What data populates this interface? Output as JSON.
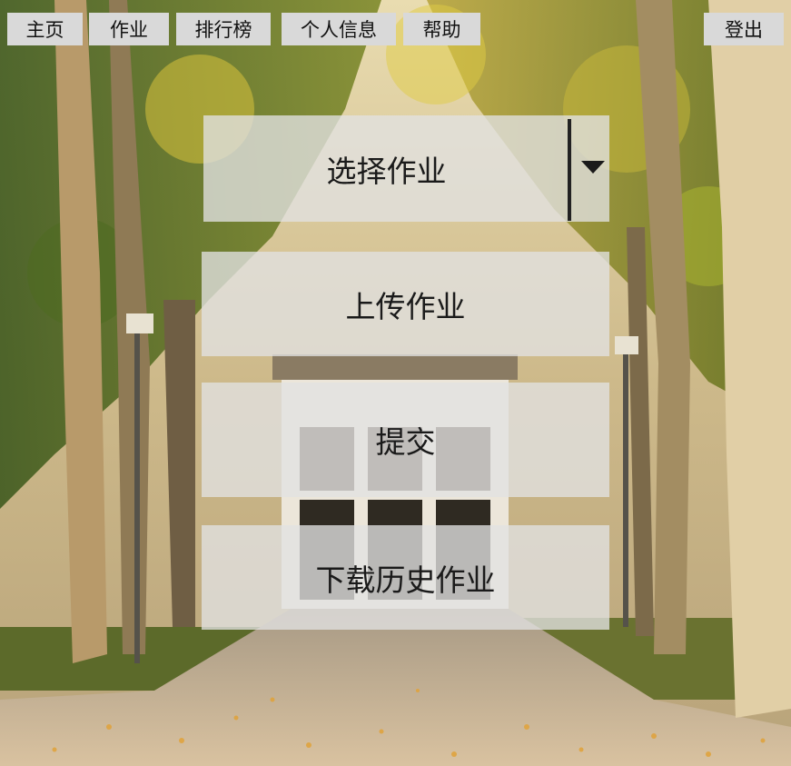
{
  "nav": {
    "home": "主页",
    "homework": "作业",
    "ranking": "排行榜",
    "profile": "个人信息",
    "help": "帮助",
    "logout": "登出"
  },
  "homework_select": {
    "selected": "选择作业",
    "icon": "chevron-down-icon"
  },
  "actions": {
    "upload": "上传作业",
    "submit": "提交",
    "download_history": "下载历史作业"
  },
  "colors": {
    "nav_button_bg": "#d9d9d9",
    "panel_bg": "rgba(225,225,225,0.78)",
    "text": "#1a1a1a"
  }
}
